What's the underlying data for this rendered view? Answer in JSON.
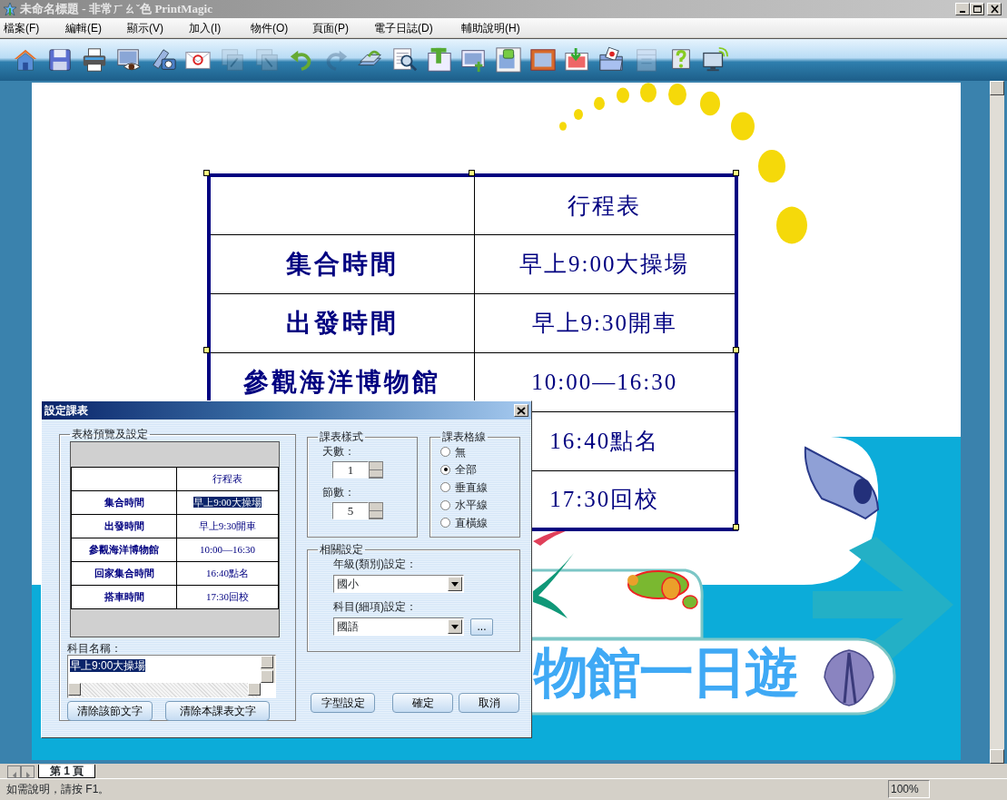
{
  "window": {
    "title": "未命名標題 - 非常ㄏㄠˇ色 PrintMagic"
  },
  "menu": [
    "檔案(F)",
    "編輯(E)",
    "顯示(V)",
    "加入(I)",
    "物件(O)",
    "頁面(P)",
    "電子日誌(D)",
    "輔助說明(H)"
  ],
  "toolbar": [
    {
      "kind": "home",
      "disabled": false
    },
    {
      "kind": "save",
      "disabled": false
    },
    {
      "kind": "print",
      "disabled": false
    },
    {
      "kind": "preview",
      "disabled": false
    },
    {
      "kind": "scan",
      "disabled": false
    },
    {
      "kind": "email",
      "disabled": false
    },
    {
      "kind": "front",
      "disabled": true
    },
    {
      "kind": "back",
      "disabled": true
    },
    {
      "kind": "undo",
      "disabled": false
    },
    {
      "kind": "redo",
      "disabled": true
    },
    {
      "kind": "rotate",
      "disabled": false
    },
    {
      "kind": "zoom",
      "disabled": false
    },
    {
      "kind": "text",
      "disabled": false
    },
    {
      "kind": "imagetext",
      "disabled": false
    },
    {
      "kind": "picture",
      "disabled": false
    },
    {
      "kind": "frame",
      "disabled": false
    },
    {
      "kind": "import",
      "disabled": false
    },
    {
      "kind": "folder",
      "disabled": false
    },
    {
      "kind": "calendar",
      "disabled": true
    },
    {
      "kind": "help",
      "disabled": false
    },
    {
      "kind": "monitor",
      "disabled": false
    }
  ],
  "document": {
    "table": {
      "rows": [
        {
          "value": "行程表"
        },
        {
          "label": "集合時間",
          "value": "早上9:00大操場"
        },
        {
          "label": "出發時間",
          "value": "早上9:30開車"
        },
        {
          "label": "參觀海洋博物館",
          "value": "10:00—16:30"
        },
        {
          "value": "16:40點名"
        },
        {
          "value": "17:30回校"
        }
      ]
    },
    "banner": "物館一日遊"
  },
  "dialog": {
    "title": "設定課表",
    "preview": {
      "title": "表格預覽及設定",
      "rows": [
        {
          "value": "行程表",
          "selected": false
        },
        {
          "label": "集合時間",
          "value": "早上9:00大操場",
          "selected": true
        },
        {
          "label": "出發時間",
          "value": "早上9:30開車",
          "selected": false
        },
        {
          "label": "參觀海洋博物館",
          "value": "10:00—16:30",
          "selected": false
        },
        {
          "label": "回家集合時間",
          "value": "16:40點名",
          "selected": false
        },
        {
          "label": "搭車時間",
          "value": "17:30回校",
          "selected": false
        }
      ]
    },
    "subject_label": "科目名稱：",
    "subject_value": "早上9:00大操場",
    "clear_buttons": [
      "清除該節文字",
      "清除本課表文字"
    ],
    "style": {
      "title": "課表樣式",
      "days_label": "天數：",
      "days": "1",
      "periods_label": "節數：",
      "periods": "5"
    },
    "gridlines": {
      "title": "課表格線",
      "options": [
        {
          "label": "無",
          "selected": false
        },
        {
          "label": "全部",
          "selected": true
        },
        {
          "label": "垂直線",
          "selected": false
        },
        {
          "label": "水平線",
          "selected": false
        },
        {
          "label": "直橫線",
          "selected": false
        }
      ]
    },
    "related": {
      "title": "相關設定",
      "grade_label": "年級(類別)設定：",
      "grade": "國小",
      "subject_label": "科目(細項)設定：",
      "subject": "國語",
      "more_button": "..."
    },
    "buttons": [
      "字型設定",
      "確定",
      "取消"
    ]
  },
  "page_tabs": [
    {
      "label": "第 1 頁",
      "selected": true
    }
  ],
  "status_bar": {
    "message": "如需說明，請按 F1。",
    "zoom": "100%"
  }
}
